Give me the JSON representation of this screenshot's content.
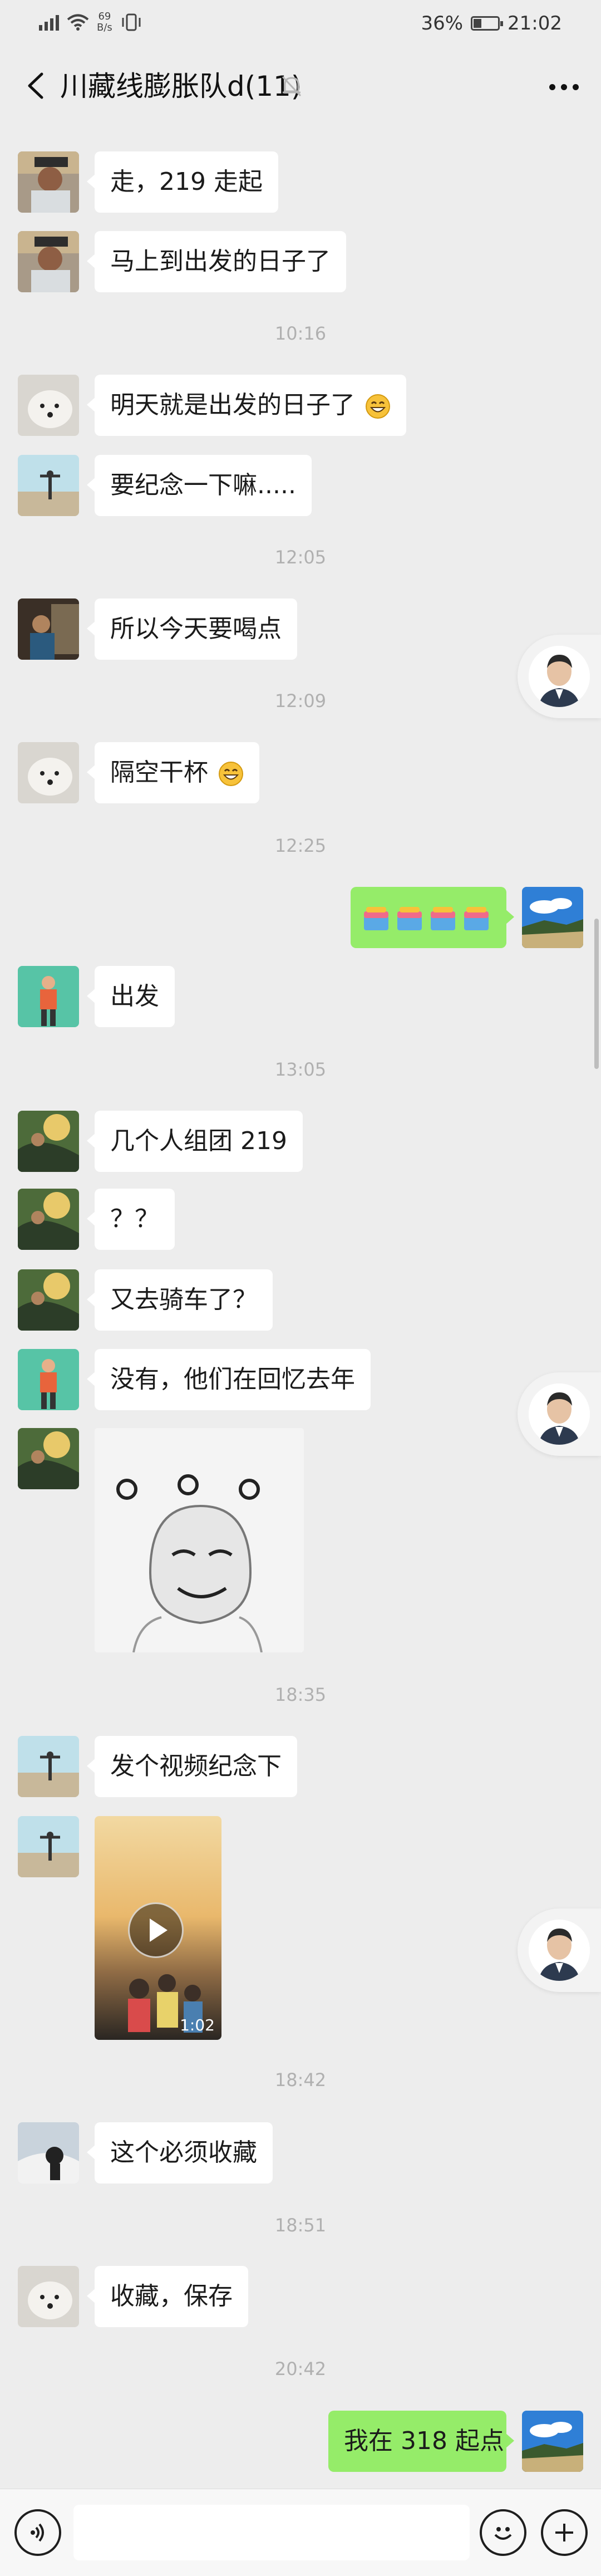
{
  "status_bar": {
    "speed_value": "69",
    "speed_unit": "B/s",
    "battery": "36%",
    "battery_level": 0.36,
    "time": "21:02"
  },
  "header": {
    "title": "川藏线膨胀队d(11)",
    "back_icon": "chevron-left-icon",
    "mute_icon": "bell-off-icon",
    "more_icon": "more-dots-icon"
  },
  "messages": [
    {
      "text": "走，219 走起"
    },
    {
      "text": "马上到出发的日子了"
    },
    {
      "time": "10:16"
    },
    {
      "text": "明天就是出发的日子了",
      "emoji": "grin-emoji"
    },
    {
      "text": "要纪念一下嘛....."
    },
    {
      "time": "12:05"
    },
    {
      "text": "所以今天要喝点"
    },
    {
      "time": "12:09"
    },
    {
      "text": "隔空干杯",
      "emoji": "grin-emoji"
    },
    {
      "time": "12:25"
    },
    {
      "sender": "me",
      "emoji": "cake-emoji",
      "count": 4
    },
    {
      "text": "出发"
    },
    {
      "time": "13:05"
    },
    {
      "text": "几个人组团 219"
    },
    {
      "text": "？？"
    },
    {
      "text": "又去骑车了？"
    },
    {
      "text": "没有，他们在回忆去年"
    },
    {
      "sticker": "meme-face-sticker"
    },
    {
      "time": "18:35"
    },
    {
      "text": "发个视频纪念下"
    },
    {
      "video_duration": "1:02",
      "play_icon": "play-icon"
    },
    {
      "time": "18:42"
    },
    {
      "text": "这个必须收藏"
    },
    {
      "time": "18:51"
    },
    {
      "text": "收藏，保存"
    },
    {
      "time": "20:42"
    },
    {
      "sender": "me",
      "text": "我在 318 起点"
    }
  ],
  "input_bar": {
    "voice_icon": "voice-icon",
    "emoji_icon": "smiley-icon",
    "plus_icon": "plus-icon",
    "placeholder": ""
  }
}
